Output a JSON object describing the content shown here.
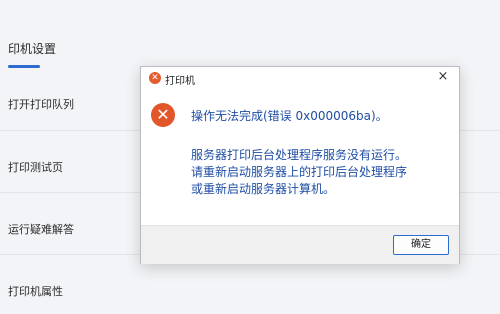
{
  "settings_page": {
    "title": "印机设置",
    "items": [
      {
        "label": "打开打印队列"
      },
      {
        "label": "打印测试页"
      },
      {
        "label": "运行疑难解答"
      },
      {
        "label": "打印机属性"
      }
    ]
  },
  "dialog": {
    "title": "打印机",
    "close_glyph": "×",
    "title_icon_glyph": "✕",
    "error_icon_glyph": "✕",
    "message_main": "操作无法完成(错误 0x000006ba)。",
    "message_detail": [
      "服务器打印后台处理程序服务没有运行。",
      "请重新启动服务器上的打印后台处理程序",
      "或重新启动服务器计算机。"
    ],
    "ok_button": "确定"
  },
  "colors": {
    "error_red": "#e1572a",
    "message_blue": "#1f4ea5",
    "accent": "#2e6bd0"
  }
}
